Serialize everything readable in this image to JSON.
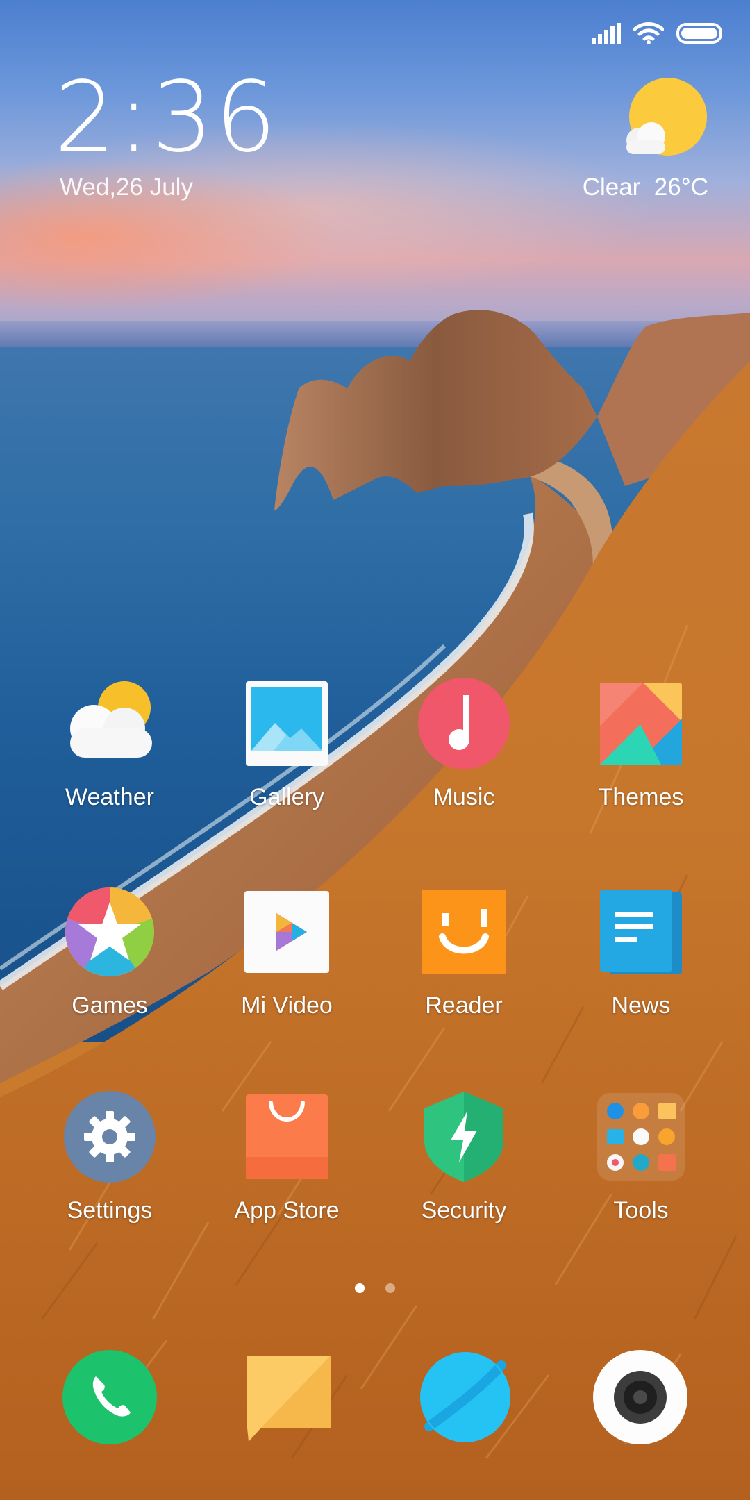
{
  "status_bar": {
    "signal": "signal-icon",
    "wifi": "wifi-icon",
    "battery": "battery-icon"
  },
  "clock_widget": {
    "time": "2:36",
    "date": "Wed,26 July"
  },
  "weather_widget": {
    "condition": "Clear",
    "temperature": "26°C",
    "icon": "sun-cloud-icon"
  },
  "apps": [
    {
      "label": "Weather",
      "icon": "weather-icon"
    },
    {
      "label": "Gallery",
      "icon": "gallery-icon"
    },
    {
      "label": "Music",
      "icon": "music-icon"
    },
    {
      "label": "Themes",
      "icon": "themes-icon"
    },
    {
      "label": "Games",
      "icon": "games-icon"
    },
    {
      "label": "Mi Video",
      "icon": "mi-video-icon"
    },
    {
      "label": "Reader",
      "icon": "reader-icon"
    },
    {
      "label": "News",
      "icon": "news-icon"
    },
    {
      "label": "Settings",
      "icon": "settings-icon"
    },
    {
      "label": "App Store",
      "icon": "app-store-icon"
    },
    {
      "label": "Security",
      "icon": "security-icon"
    },
    {
      "label": "Tools",
      "icon": "tools-folder-icon"
    }
  ],
  "page_indicator": {
    "pages": 2,
    "current": 1
  },
  "dock": [
    {
      "name": "phone",
      "icon": "phone-icon"
    },
    {
      "name": "messages",
      "icon": "messages-icon"
    },
    {
      "name": "browser",
      "icon": "browser-icon"
    },
    {
      "name": "camera",
      "icon": "camera-icon"
    }
  ]
}
